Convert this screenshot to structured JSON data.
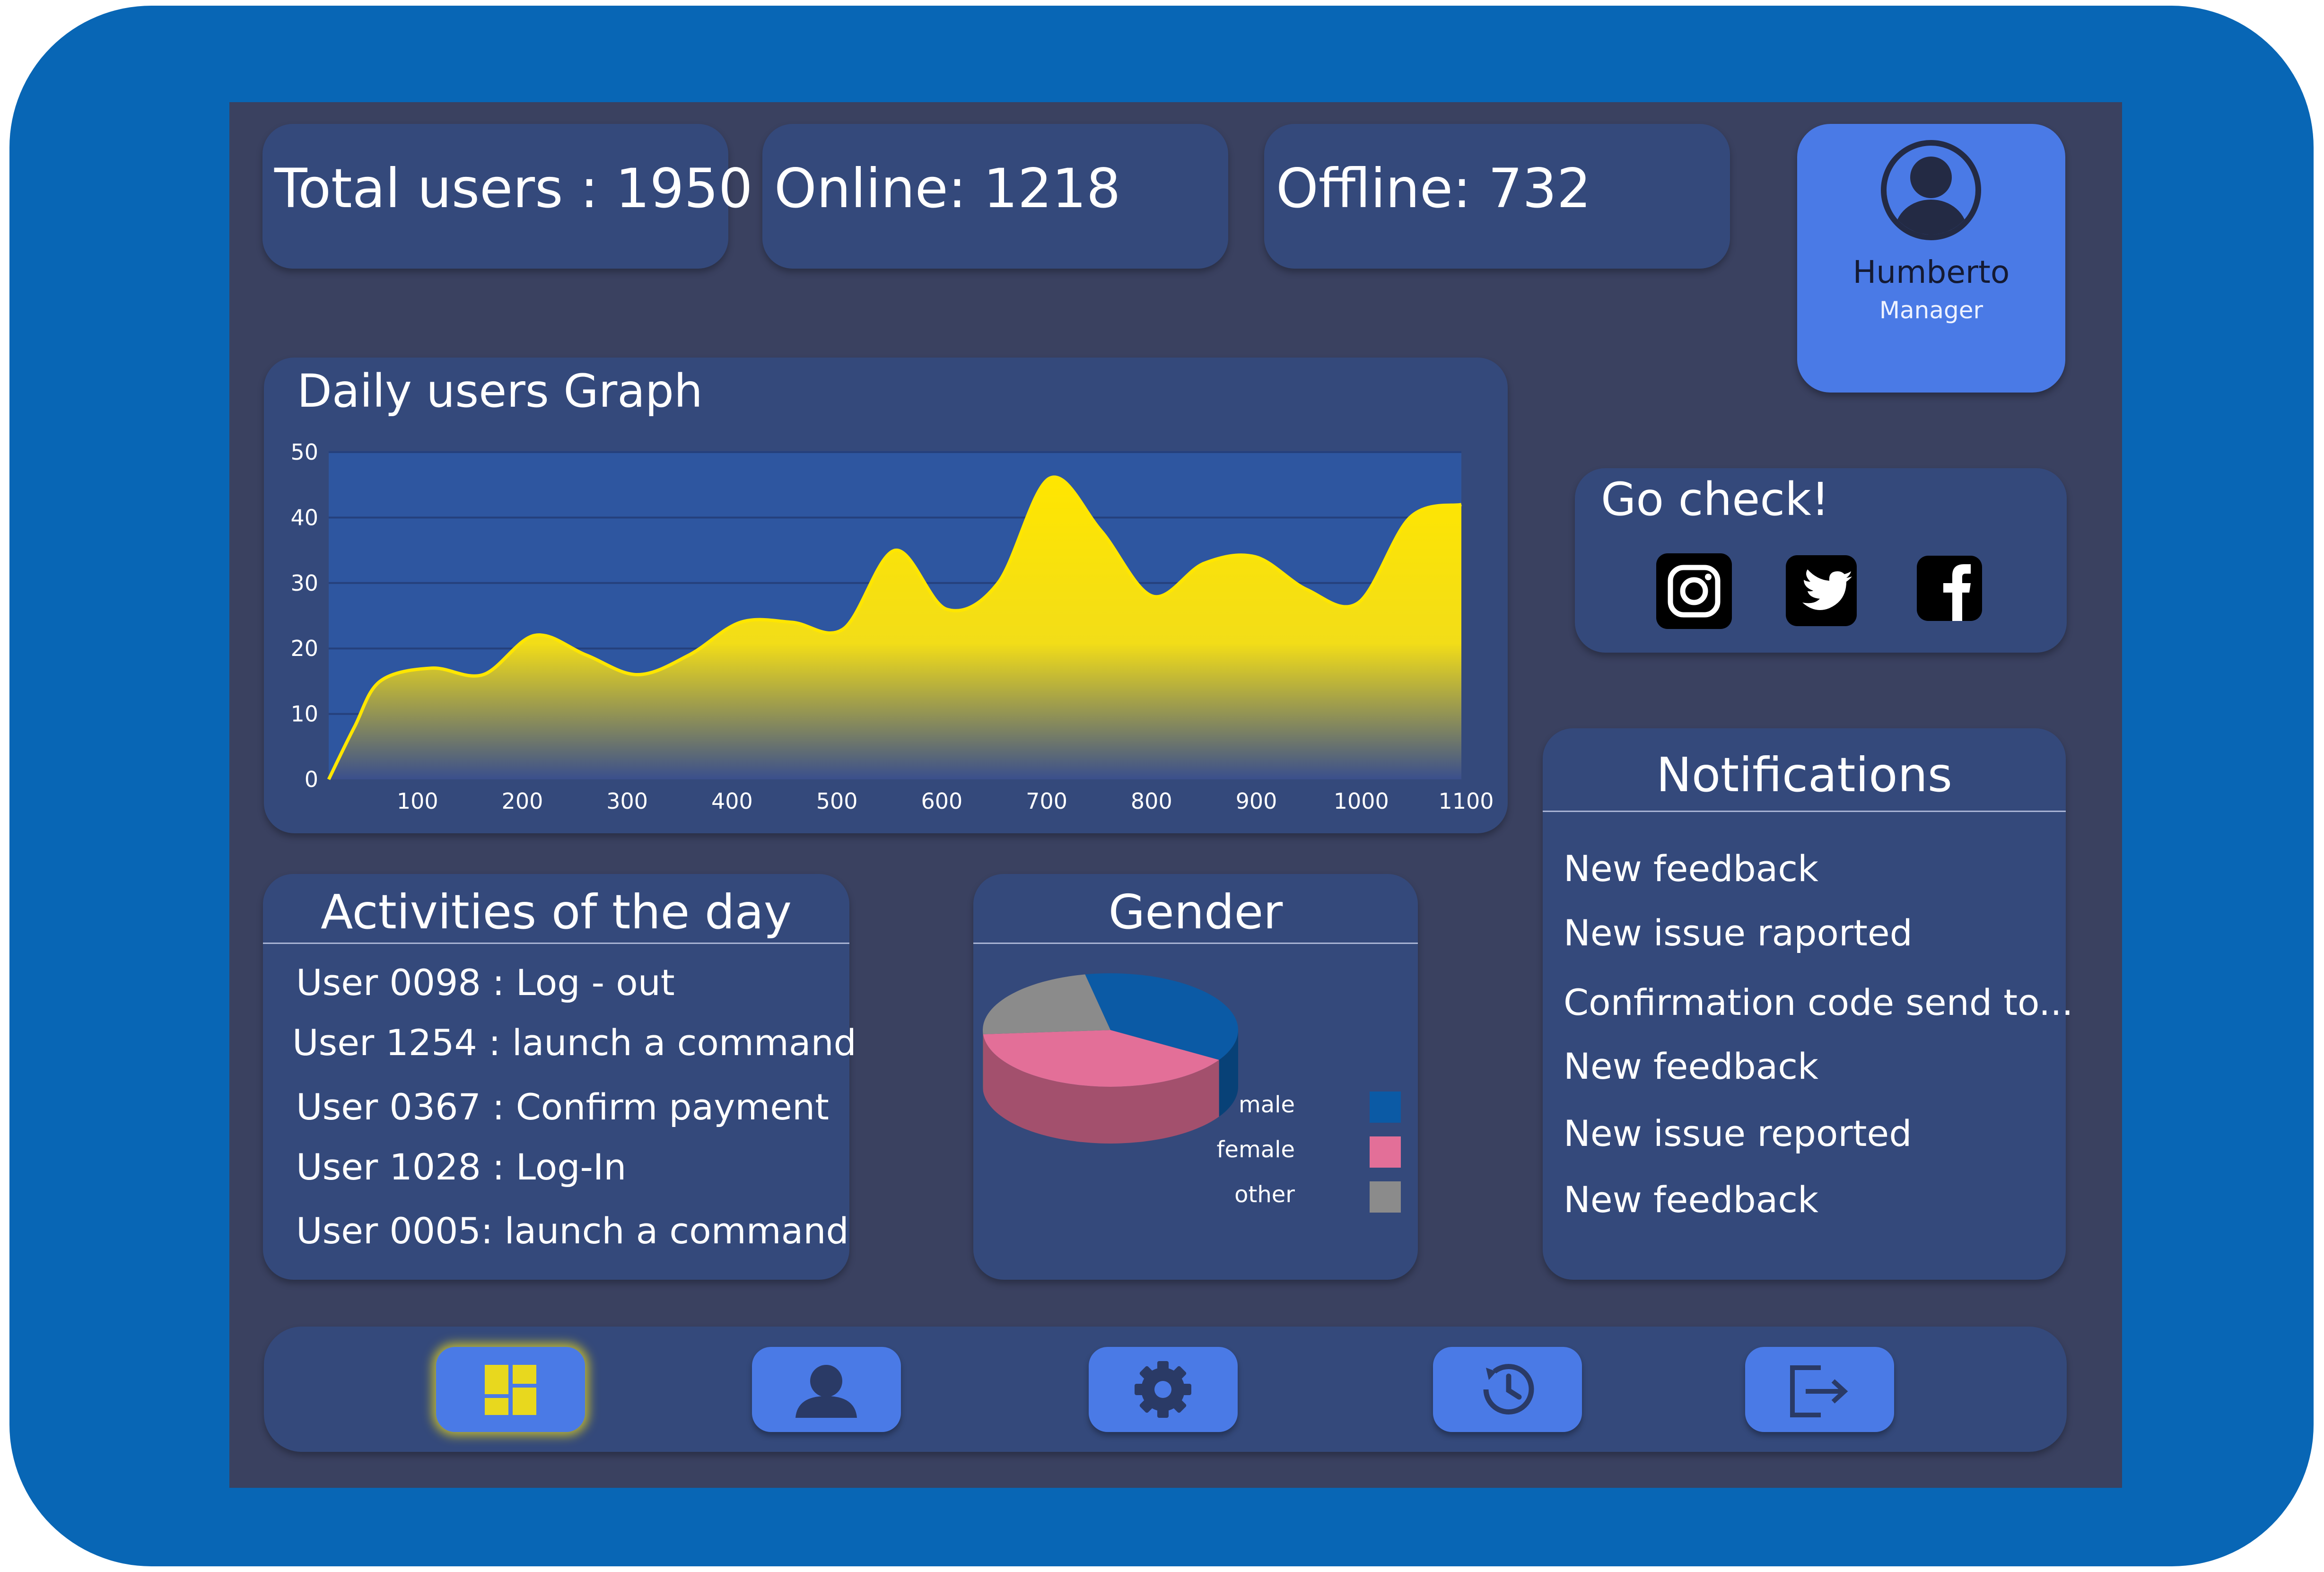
{
  "stats": {
    "total_label": "Total users : 1950",
    "online_label": "Online: 1218",
    "offline_label": "Offline: 732"
  },
  "profile": {
    "name": "Humberto",
    "role": "Manager",
    "icon": "user-avatar-icon"
  },
  "daily_graph": {
    "title": "Daily users Graph"
  },
  "chart_data": {
    "type": "area",
    "x": [
      0,
      25,
      50,
      100,
      150,
      200,
      250,
      300,
      350,
      400,
      450,
      500,
      550,
      600,
      650,
      700,
      750,
      800,
      850,
      900,
      950,
      1000,
      1050,
      1100
    ],
    "values": [
      0,
      8,
      15,
      17,
      16,
      22,
      19,
      16,
      19,
      24,
      24,
      23,
      35,
      26,
      30,
      46,
      38,
      28,
      33,
      34,
      29,
      27,
      40,
      42
    ],
    "title": "Daily users Graph",
    "xlabel": "",
    "ylabel": "",
    "xlim": [
      0,
      1100
    ],
    "ylim": [
      0,
      50
    ],
    "x_ticks": [
      "100",
      "200",
      "300",
      "400",
      "500",
      "600",
      "700",
      "800",
      "900",
      "1000",
      "1100"
    ],
    "y_ticks": [
      "0",
      "10",
      "20",
      "30",
      "40",
      "50"
    ],
    "grid": true,
    "fill_colors": [
      "#ffe600",
      "#3a4f8c"
    ],
    "line_color": "#ffe600",
    "plot_background": "#2e56a0"
  },
  "social": {
    "title": "Go check!",
    "icons": [
      "instagram-icon",
      "twitter-icon",
      "facebook-icon"
    ]
  },
  "activities": {
    "title": "Activities of the day",
    "items": [
      "User 0098 : Log - out",
      "User 1254 : launch a command",
      "User 0367 : Confirm payment",
      "User 1028 : Log-In",
      "User 0005: launch a command"
    ]
  },
  "gender": {
    "title": "Gender",
    "slices": [
      {
        "label": "male",
        "value": 0.37,
        "color": "#0b5aa5"
      },
      {
        "label": "female",
        "value": 0.4,
        "color": "#e36f98"
      },
      {
        "label": "other",
        "value": 0.23,
        "color": "#8b8b8b"
      }
    ]
  },
  "notifications": {
    "title": "Notifications",
    "items": [
      "New feedback",
      "New issue raported",
      "Confirmation code send to...",
      "New feedback",
      "New issue reported",
      "New feedback"
    ]
  },
  "nav": {
    "buttons": [
      "dashboard-icon",
      "user-icon",
      "settings-icon",
      "history-icon",
      "logout-icon"
    ],
    "active_index": 0,
    "active_color": "#e8d81e",
    "icon_color": "#2a3a66"
  },
  "colors": {
    "frame": "#0866b5",
    "screen": "#3a4160",
    "card": "#34497b",
    "accent": "#4a7ae6"
  }
}
